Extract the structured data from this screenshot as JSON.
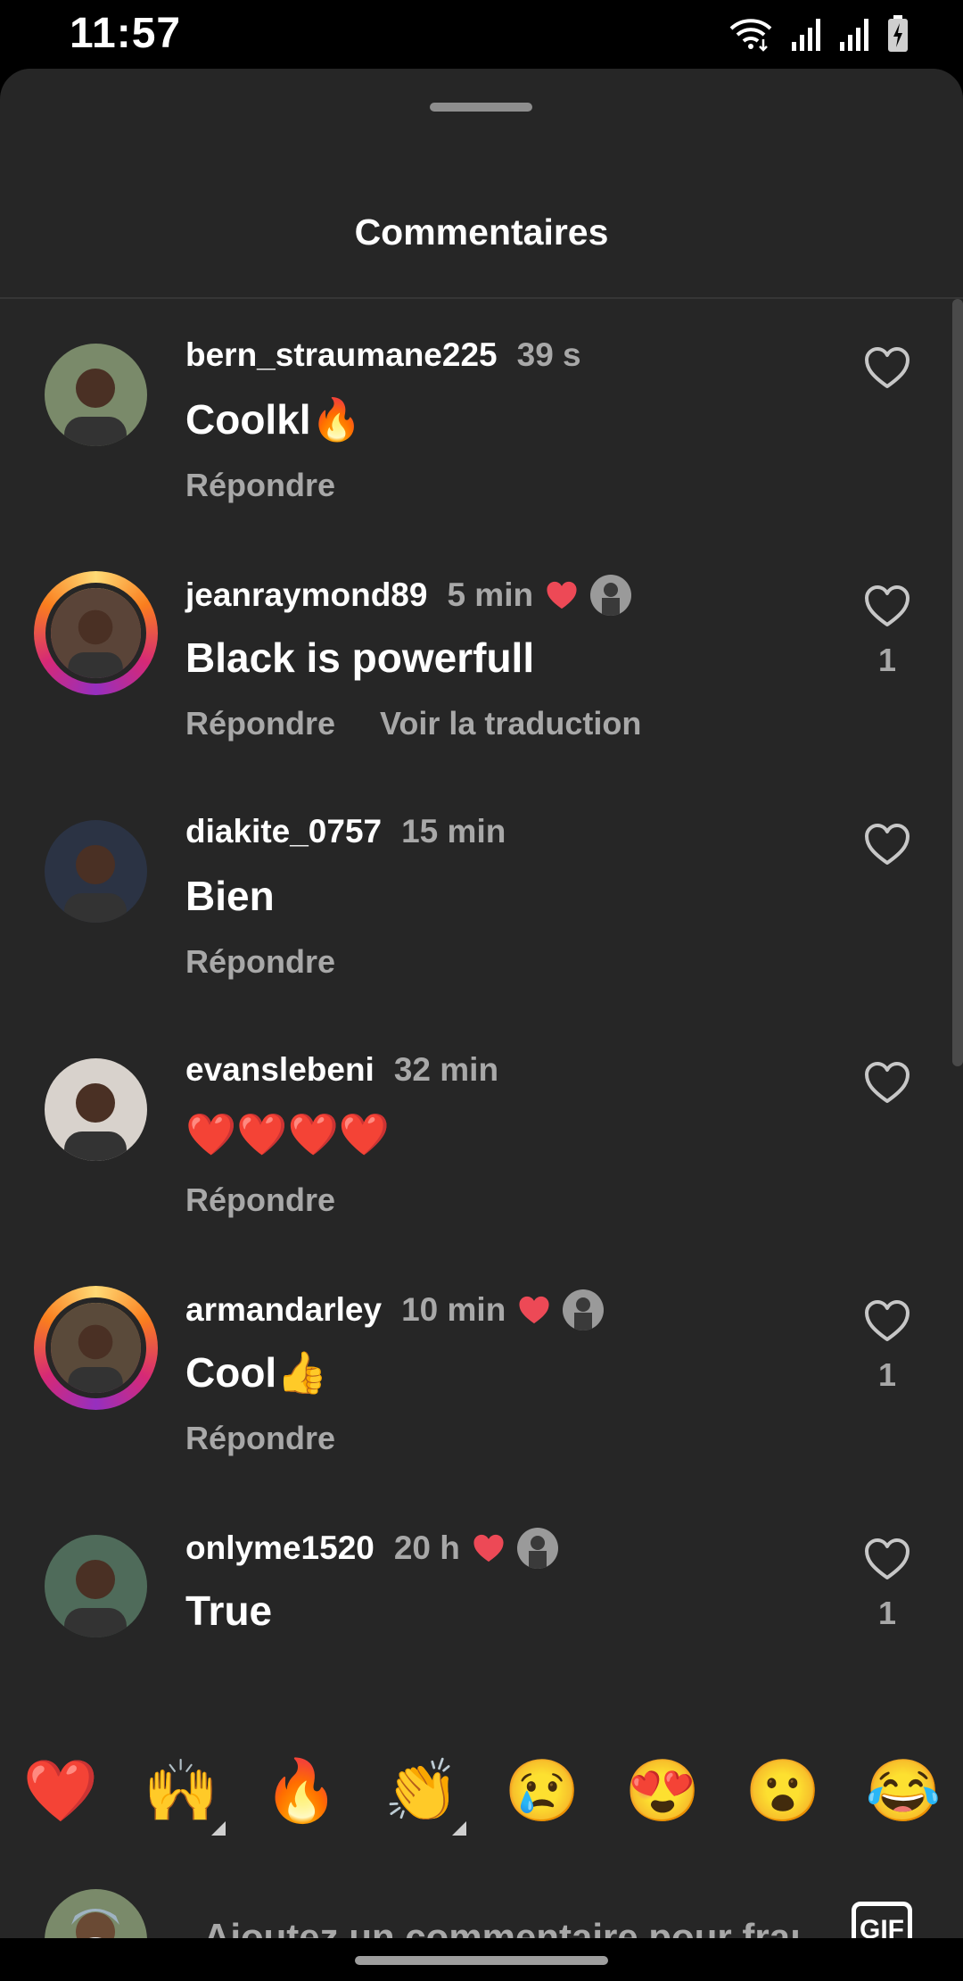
{
  "status_bar": {
    "time": "11:57"
  },
  "sheet": {
    "title": "Commentaires"
  },
  "comments": [
    {
      "username": "bern_straumane225",
      "time": "39 s",
      "text": "Coolkl🔥",
      "reply_label": "Répondre",
      "translate_label": "",
      "likes": "",
      "liked_by_author": false,
      "story_ring": false,
      "avatar_color": "#7a8a6a"
    },
    {
      "username": "jeanraymond89",
      "time": "5 min",
      "text": "Black is powerfull",
      "reply_label": "Répondre",
      "translate_label": "Voir la traduction",
      "likes": "1",
      "liked_by_author": true,
      "story_ring": true,
      "avatar_color": "#5a4438"
    },
    {
      "username": "diakite_0757",
      "time": "15 min",
      "text": "Bien",
      "reply_label": "Répondre",
      "translate_label": "",
      "likes": "",
      "liked_by_author": false,
      "story_ring": false,
      "avatar_color": "#2b3344"
    },
    {
      "username": "evanslebeni",
      "time": "32 min",
      "text": "❤️❤️❤️❤️",
      "reply_label": "Répondre",
      "translate_label": "",
      "likes": "",
      "liked_by_author": false,
      "story_ring": false,
      "avatar_color": "#d8d2cc"
    },
    {
      "username": "armandarley",
      "time": "10 min",
      "text": "Cool👍",
      "reply_label": "Répondre",
      "translate_label": "",
      "likes": "1",
      "liked_by_author": true,
      "story_ring": true,
      "avatar_color": "#5a4a3a"
    },
    {
      "username": "onlyme1520",
      "time": "20 h",
      "text": "True",
      "reply_label": "",
      "translate_label": "",
      "likes": "1",
      "liked_by_author": true,
      "story_ring": false,
      "avatar_color": "#4f6b5a"
    }
  ],
  "reactions": [
    {
      "emoji": "❤️",
      "name": "heart",
      "has_skin_tones": false
    },
    {
      "emoji": "🙌",
      "name": "raising-hands",
      "has_skin_tones": true
    },
    {
      "emoji": "🔥",
      "name": "fire",
      "has_skin_tones": false
    },
    {
      "emoji": "👏",
      "name": "clapping-hands",
      "has_skin_tones": true
    },
    {
      "emoji": "😢",
      "name": "crying-face",
      "has_skin_tones": false
    },
    {
      "emoji": "😍",
      "name": "heart-eyes",
      "has_skin_tones": false
    },
    {
      "emoji": "😮",
      "name": "open-mouth",
      "has_skin_tones": false
    },
    {
      "emoji": "😂",
      "name": "tears-of-joy",
      "has_skin_tones": false
    }
  ],
  "composer": {
    "placeholder": "Ajoutez un commentaire pour fraı",
    "gif_label": "GIF"
  },
  "colors": {
    "background": "#262626",
    "muted": "#a8a8a8",
    "heart_red": "#ed4956"
  }
}
